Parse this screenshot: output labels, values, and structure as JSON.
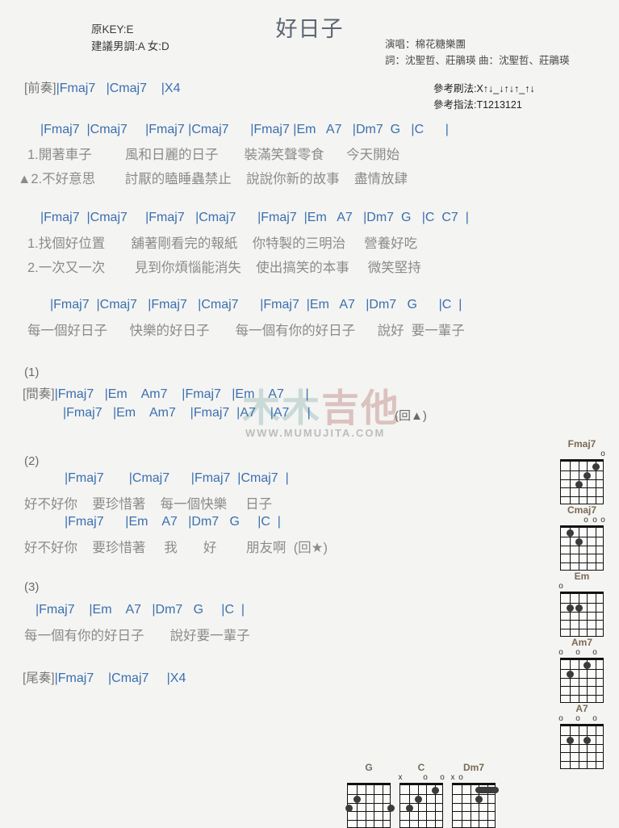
{
  "song": {
    "title": "好日子",
    "original_key": "原KEY:E",
    "suggested_key": "建議男調:A 女:D",
    "singer": "演唱：棉花糖樂團",
    "writers": "詞：沈聖哲、莊鵑瑛  曲：沈聖哲、莊鵑瑛",
    "strum_pattern": "參考刷法:X↑↓_↓↑↓↑_↑↓",
    "finger_pattern": "參考指法:T1213121"
  },
  "watermark": {
    "cn_left": "木木",
    "cn_right": "吉他",
    "url": "WWW.MUMUJITA.COM"
  },
  "colors": {
    "chord": "#3a6fb0",
    "lyric": "#8b8b8b",
    "title": "#5d6673",
    "diagram_name": "#7a6a55"
  },
  "intro": {
    "label": "[前奏]",
    "chords": "|Fmaj7   |Cmaj7    |X4"
  },
  "verse1": {
    "chords": "|Fmaj7  |Cmaj7     |Fmaj7 |Cmaj7      |Fmaj7 |Em   A7   |Dm7  G   |C      |",
    "line1": "1.開著車子         風和日麗的日子       裝滿笑聲零食      今天開始",
    "line2": "▲2.不好意思        討厭的瞌睡蟲禁止    說說你新的故事    盡情放肆"
  },
  "verse2": {
    "chords": "|Fmaj7  |Cmaj7     |Fmaj7   |Cmaj7      |Fmaj7  |Em   A7   |Dm7  G   |C  C7  |",
    "line1": "1.找個好位置       舖著剛看完的報紙    你特製的三明治     營養好吃",
    "line2": "2.一次又一次        見到你煩惱能消失    使出搞笑的本事     微笑堅持"
  },
  "chorus": {
    "chords": "|Fmaj7  |Cmaj7   |Fmaj7   |Cmaj7      |Fmaj7  |Em   A7   |Dm7   G      |C  |",
    "lyrics": "每一個好日子      快樂的好日子       每一個有你的好日子      說好  要一輩子"
  },
  "section1": {
    "number": "(1)",
    "label": "[間奏]",
    "line1": "|Fmaj7   |Em    Am7    |Fmaj7   |Em    A7      |",
    "line2": "|Fmaj7   |Em    Am7    |Fmaj7  |A7    |A7     |",
    "repeat_note": "(回▲)"
  },
  "section2": {
    "number": "(2)",
    "chord_line1": "|Fmaj7       |Cmaj7      |Fmaj7  |Cmaj7  |",
    "lyric_line1": "好不好你    要珍惜著    每一個快樂     日子",
    "chord_line2": "|Fmaj7      |Em    A7   |Dm7   G     |C  |",
    "lyric_line2": "好不好你    要珍惜著     我       好        朋友啊  (回★)"
  },
  "section3": {
    "number": "(3)",
    "chords": "|Fmaj7    |Em    A7   |Dm7   G     |C  |",
    "lyrics": "每一個有你的好日子       說好要一輩子"
  },
  "outro": {
    "label": "[尾奏]",
    "chords": "|Fmaj7    |Cmaj7     |X4"
  },
  "chord_diagrams_right": [
    {
      "name": "Fmaj7",
      "open_marks": [
        {
          "string": 1,
          "sym": "o"
        }
      ],
      "dots": [
        {
          "string": 2,
          "fret": 1
        },
        {
          "string": 3,
          "fret": 2
        },
        {
          "string": 4,
          "fret": 3
        }
      ]
    },
    {
      "name": "Cmaj7",
      "open_marks": [
        {
          "string": 1,
          "sym": "o"
        },
        {
          "string": 2,
          "sym": "o"
        },
        {
          "string": 3,
          "sym": "o"
        }
      ],
      "dots": [
        {
          "string": 4,
          "fret": 2
        },
        {
          "string": 5,
          "fret": 1
        }
      ]
    },
    {
      "name": "Em",
      "open_marks": [
        {
          "string": 6,
          "sym": "o"
        }
      ],
      "dots": [
        {
          "string": 5,
          "fret": 2
        },
        {
          "string": 4,
          "fret": 2
        }
      ]
    },
    {
      "name": "Am7",
      "open_marks": [
        {
          "string": 6,
          "sym": "o"
        },
        {
          "string": 4,
          "sym": "o"
        },
        {
          "string": 2,
          "sym": "o"
        }
      ],
      "dots": [
        {
          "string": 3,
          "fret": 1
        },
        {
          "string": 5,
          "fret": 2
        }
      ]
    },
    {
      "name": "A7",
      "open_marks": [
        {
          "string": 6,
          "sym": "o"
        },
        {
          "string": 4,
          "sym": "o"
        },
        {
          "string": 2,
          "sym": "o"
        }
      ],
      "dots": [
        {
          "string": 5,
          "fret": 2
        },
        {
          "string": 3,
          "fret": 2
        }
      ]
    }
  ],
  "chord_diagrams_bottom": [
    {
      "name": "G",
      "open_marks": [],
      "dots": [
        {
          "string": 5,
          "fret": 2
        },
        {
          "string": 6,
          "fret": 3
        },
        {
          "string": 1,
          "fret": 3
        }
      ]
    },
    {
      "name": "C",
      "open_marks": [
        {
          "string": 6,
          "sym": "x"
        },
        {
          "string": 3,
          "sym": "o"
        },
        {
          "string": 1,
          "sym": "o"
        }
      ],
      "dots": [
        {
          "string": 2,
          "fret": 1
        },
        {
          "string": 4,
          "fret": 2
        },
        {
          "string": 5,
          "fret": 3
        }
      ]
    },
    {
      "name": "Dm7",
      "open_marks": [
        {
          "string": 6,
          "sym": "x"
        },
        {
          "string": 5,
          "sym": "o"
        }
      ],
      "dots": [
        {
          "string": 3,
          "fret": 2
        }
      ],
      "barre": {
        "fret": 1,
        "from": 3,
        "to": 1
      }
    }
  ]
}
